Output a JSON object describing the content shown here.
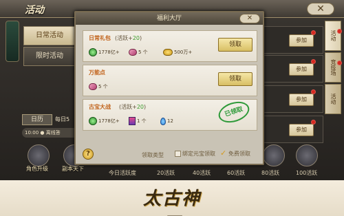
{
  "window": {
    "title": "活动"
  },
  "left_tabs": [
    {
      "label": "日常活动",
      "active": true
    },
    {
      "label": "限时活动",
      "active": false
    }
  ],
  "calendar_label": "日历",
  "daily_text": "每日5",
  "time_text": "10:00 ● 离线答",
  "bottom_icons": [
    {
      "label": "角色升级",
      "icon": "character-upgrade-icon"
    },
    {
      "label": "副本天下",
      "icon": "dungeon-icon"
    }
  ],
  "progress": {
    "labels": [
      "今日活跃度",
      "20活跃",
      "40活跃",
      "60活跃",
      "80活跃",
      "100活跃"
    ]
  },
  "right_rows": [
    {
      "join_label": "参加"
    },
    {
      "join_label": "参加"
    },
    {
      "join_label": "参加"
    },
    {
      "join_label": "参加"
    }
  ],
  "side_tabs": [
    {
      "label": "活动",
      "active": true
    },
    {
      "label": "竞技场",
      "active": false
    },
    {
      "label": "活动",
      "active": false
    }
  ],
  "dialog": {
    "title": "福利大厅",
    "close_symbol": "✕",
    "cards": [
      {
        "title": "日常礼包",
        "activity_prefix": "(活跃+",
        "activity_value": "20",
        "activity_suffix": ")",
        "rewards": [
          {
            "icon": "jade-icon",
            "text": "1778亿+"
          },
          {
            "icon": "pill-icon",
            "text": "5 个"
          },
          {
            "icon": "coin-icon",
            "text": "500万+"
          }
        ],
        "button_label": "领取",
        "claimed": false
      },
      {
        "title": "万能点",
        "rewards": [
          {
            "icon": "pill-icon",
            "text": "5 个"
          }
        ],
        "button_label": "领取",
        "claimed": false
      },
      {
        "title": "古宝大战",
        "activity_prefix": "(活跃+",
        "activity_value": "20",
        "activity_suffix": ")",
        "rewards": [
          {
            "icon": "jade-icon",
            "text": "1778亿+"
          },
          {
            "icon": "gift-icon",
            "text": "1 个"
          },
          {
            "icon": "water-drop-icon",
            "text": "12"
          }
        ],
        "stamp_label": "已领取",
        "claimed": true
      }
    ],
    "footer": {
      "help_symbol": "?",
      "claim_type_label": "领取类型",
      "option_bound": "绑定元宝领取",
      "option_free": "免费领取"
    }
  },
  "banner": {
    "logo_text": "太古神王"
  },
  "colors": {
    "accent_green": "#3a9c2b",
    "title_orange": "#c1621a",
    "button_gold": "#d8bf64",
    "red_dot": "#d6281f"
  }
}
